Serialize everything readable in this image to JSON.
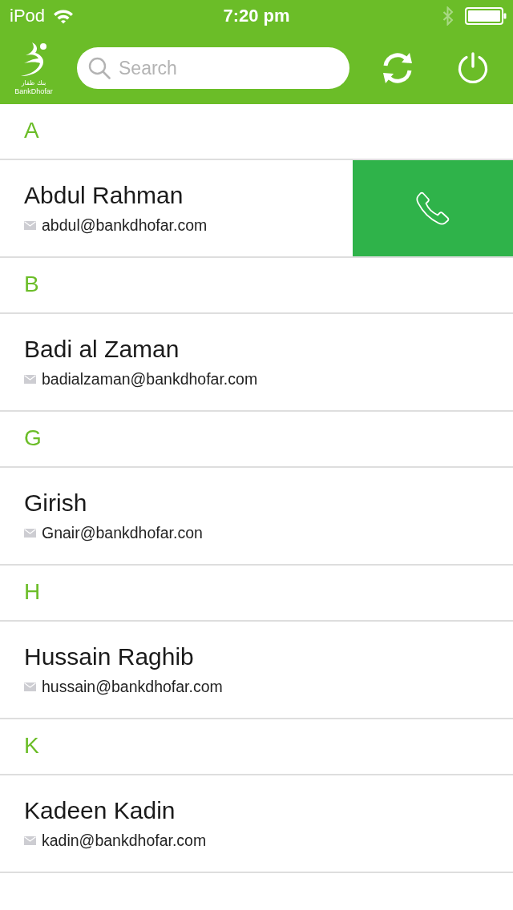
{
  "status_bar": {
    "carrier": "iPod",
    "time": "7:20 pm"
  },
  "header": {
    "logo": {
      "arabic": "بنك ظفار",
      "name": "BankDhofar"
    },
    "search": {
      "placeholder": "Search"
    }
  },
  "sections": [
    {
      "letter": "A",
      "contacts": [
        {
          "name": "Abdul Rahman",
          "email": "abdul@bankdhofar.com",
          "swiped": true
        }
      ]
    },
    {
      "letter": "B",
      "contacts": [
        {
          "name": "Badi al Zaman",
          "email": "badialzaman@bankdhofar.com",
          "swiped": false
        }
      ]
    },
    {
      "letter": "G",
      "contacts": [
        {
          "name": "Girish",
          "email": "Gnair@bankdhofar.con",
          "swiped": false
        }
      ]
    },
    {
      "letter": "H",
      "contacts": [
        {
          "name": "Hussain Raghib",
          "email": "hussain@bankdhofar.com",
          "swiped": false
        }
      ]
    },
    {
      "letter": "K",
      "contacts": [
        {
          "name": "Kadeen Kadin",
          "email": "kadin@bankdhofar.com",
          "swiped": false
        }
      ]
    }
  ]
}
